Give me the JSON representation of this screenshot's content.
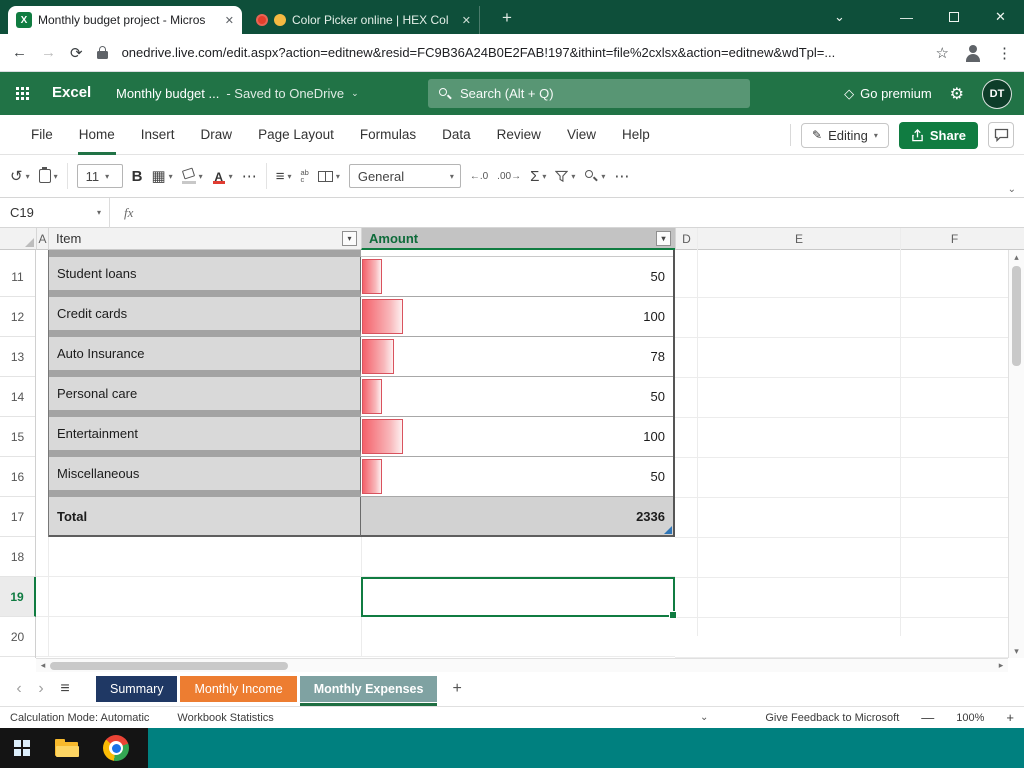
{
  "browser": {
    "tabs": [
      {
        "title": "Monthly budget project - Micros"
      },
      {
        "title": "Color Picker online | HEX Col"
      }
    ],
    "new_tab": "+",
    "url": "onedrive.live.com/edit.aspx?action=editnew&resid=FC9B36A24B0E2FAB!197&ithint=file%2cxlsx&action=editnew&wdTpl=...",
    "window": {
      "chevron": "⌄",
      "minimize": "—",
      "close": "✕",
      "tab_close": "✕"
    },
    "nav": {
      "back": "←",
      "forward": "→",
      "reload": "⟳",
      "star": "☆",
      "menu": "⋮"
    }
  },
  "excel_header": {
    "app": "Excel",
    "doc_title": "Monthly budget ...",
    "saved": "- Saved to OneDrive",
    "chevron": "⌄",
    "search_placeholder": "Search (Alt + Q)",
    "premium": "Go premium",
    "diamond": "◇",
    "gear": "⚙",
    "avatar": "DT"
  },
  "ribbon": {
    "tabs": [
      "File",
      "Home",
      "Insert",
      "Draw",
      "Page Layout",
      "Formulas",
      "Data",
      "Review",
      "View",
      "Help"
    ],
    "active_tab": "Home",
    "editing": "Editing",
    "pencil": "✎",
    "share": "Share"
  },
  "toolbar": {
    "undo": "↺",
    "font_size": "11",
    "bold": "B",
    "borders": "▦",
    "more": "⋯",
    "align": "≡",
    "wrap_top": "ab",
    "wrap_bottom": "c",
    "number_format": "General",
    "dec_left": "←.0",
    "dec_right": ".00→",
    "sum": "Σ",
    "chevron": "▾",
    "collapse": "⌄"
  },
  "formula_bar": {
    "name_box": "C19",
    "fx": "fx",
    "content": "",
    "chevron": "▾"
  },
  "grid": {
    "headers": {
      "a": "A",
      "item": "Item",
      "amount": "Amount",
      "d": "D",
      "e": "E",
      "f": "F",
      "filter": "▾"
    },
    "row_nums": [
      "11",
      "12",
      "13",
      "14",
      "15",
      "16",
      "17",
      "18",
      "19",
      "20"
    ],
    "selected_row": "19",
    "selected_cell": "C19",
    "rows": [
      {
        "n": "11",
        "item": "Student loans",
        "amount": "50",
        "bar": 20
      },
      {
        "n": "12",
        "item": "Credit cards",
        "amount": "100",
        "bar": 41
      },
      {
        "n": "13",
        "item": "Auto Insurance",
        "amount": "78",
        "bar": 32
      },
      {
        "n": "14",
        "item": "Personal care",
        "amount": "50",
        "bar": 20
      },
      {
        "n": "15",
        "item": "Entertainment",
        "amount": "100",
        "bar": 41
      },
      {
        "n": "16",
        "item": "Miscellaneous",
        "amount": "50",
        "bar": 20
      }
    ],
    "total": {
      "label": "Total",
      "amount": "2336"
    },
    "scroll": {
      "h_left": "◂",
      "h_right": "▸",
      "v_up": "▴",
      "v_down": "▾"
    }
  },
  "sheets": {
    "nav_prev": "‹",
    "nav_next": "›",
    "all_sheets": "≡",
    "add": "+",
    "tabs": [
      {
        "label": "Summary",
        "color": "#1f3864"
      },
      {
        "label": "Monthly Income",
        "color": "#ed7d31"
      },
      {
        "label": "Monthly Expenses",
        "color": "#7fa2a2"
      }
    ],
    "active_tab": "Monthly Expenses"
  },
  "status_bar": {
    "calc_mode": "Calculation Mode: Automatic",
    "workbook_stats": "Workbook Statistics",
    "chevron": "⌄",
    "feedback": "Give Feedback to Microsoft",
    "zoom_out": "—",
    "zoom": "100%",
    "zoom_in": "+"
  },
  "colors": {
    "excel_green": "#217346",
    "selection_green": "#107c41",
    "databar_red": "#f4626b",
    "tab_summary": "#1f3864",
    "tab_income": "#ed7d31",
    "tab_expenses": "#7fa2a2"
  }
}
